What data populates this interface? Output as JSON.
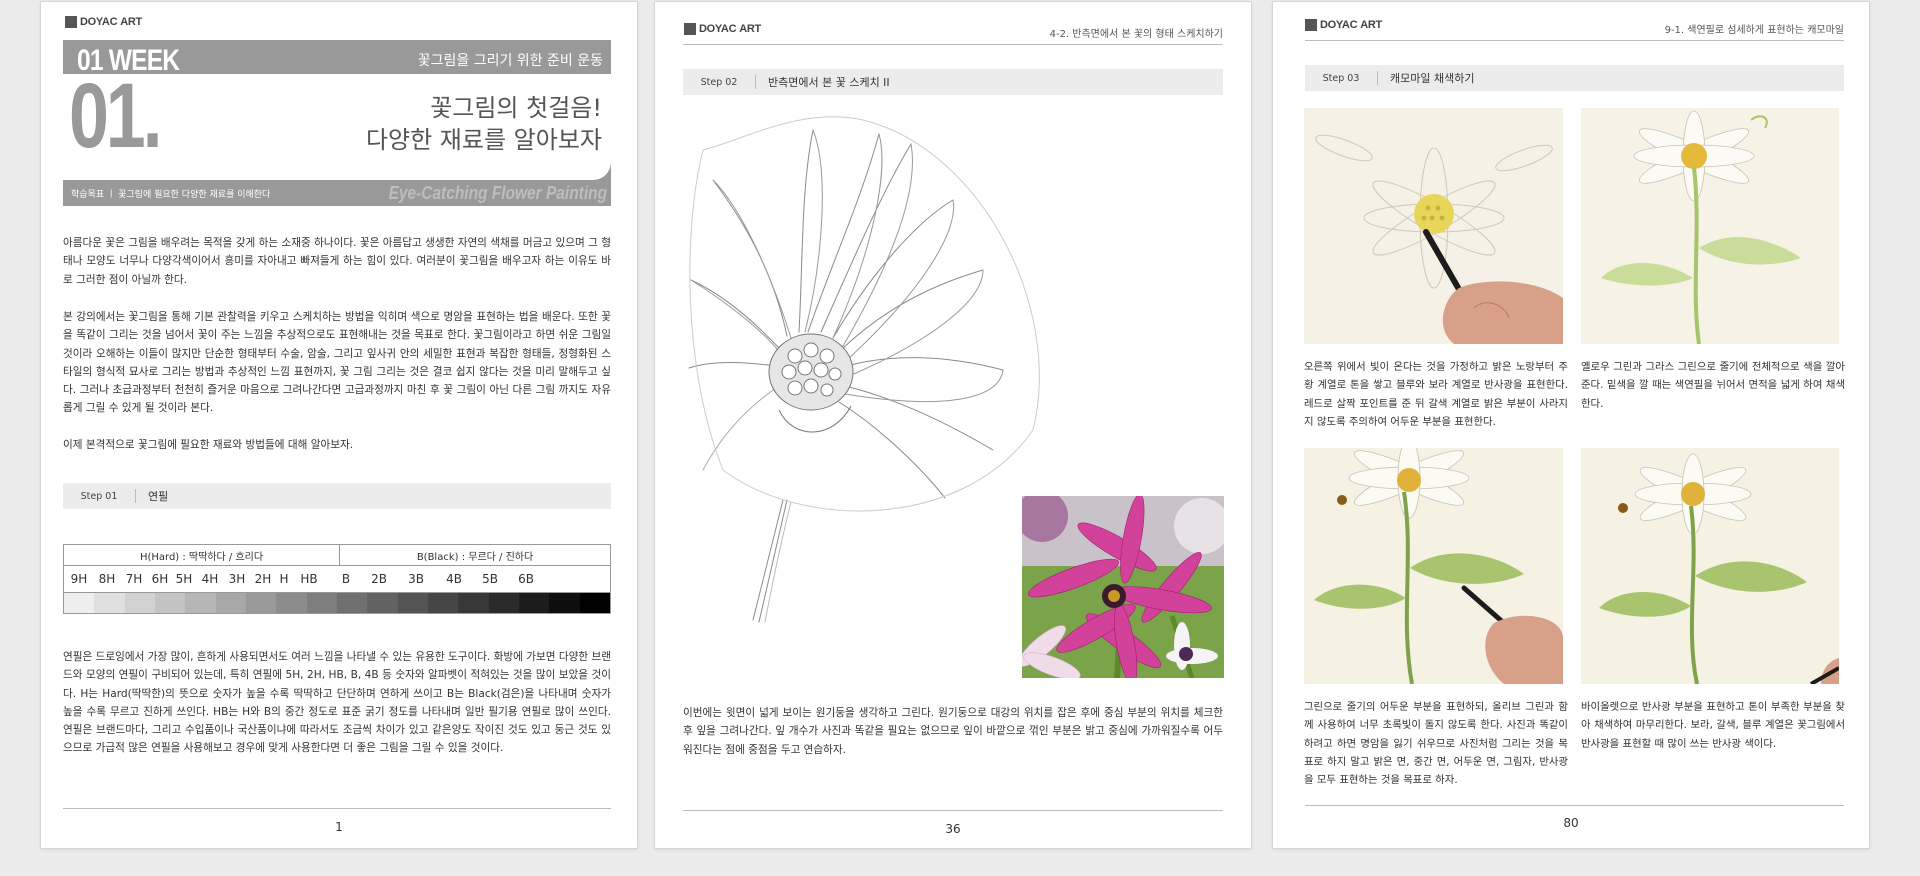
{
  "brand": {
    "logo_text_bold": "DOYAC",
    "logo_text_light": "ART"
  },
  "page1": {
    "week": "01 WEEK",
    "prep": "꽃그림을 그리기 위한 준비 운동",
    "number": "01.",
    "title_line1": "꽃그림의 첫걸음!",
    "title_line2": "다양한 재료를 알아보자",
    "objective": "학습목표 ㅣ 꽃그림에 필요한 다양한 재료를 이해한다",
    "eye_catching": "Eye-Catching Flower Painting",
    "paragraph1": "아름다운 꽃은 그림을 배우려는 목적을 갖게 하는 소재중 하나이다. 꽃은 아름답고 생생한 자연의 색채를 머금고 있으며 그 형태나 모양도 너무나 다양각색이어서 흥미를 자아내고 빠져들게 하는 힘이 있다. 여러분이 꽃그림을 배우고자 하는 이유도 바로 그러한 점이 아닐까 한다.",
    "paragraph2": "본 강의에서는 꽃그림을 통해 기본 관찰력을 키우고 스케치하는 방법을 익히며 색으로 명암을 표현하는 법을 배운다. 또한 꽃을 똑같이 그리는 것을 넘어서 꽃이 주는 느낌을 추상적으로도 표현해내는 것을 목표로 한다. 꽃그림이라고 하면 쉬운 그림일 것이라 오해하는 이들이 많지만 단순한 형태부터 수술, 암술, 그리고 잎사귀 안의 세밀한 표현과 복잡한 형태들, 정형화된 스타일의 형식적 묘사로 그리는 방법과 추상적인 느낌 표현까지, 꽃 그림 그리는 것은 결코 쉽지 않다는 것을 미리 말해두고 싶다. 그러나 초급과정부터 천천히 즐거운 마음으로 그려나간다면 고급과정까지 마친 후 꽃 그림이 아닌 다른 그림 까지도 자유롭게 그릴 수 있게 될 것이라 본다.",
    "paragraph3": "이제 본격적으로 꽃그림에 필요한 재료와 방법들에 대해 알아보자.",
    "step_label": "Step 01",
    "step_title": "연필",
    "scale_hard": "H(Hard) : 딱딱하다 / 흐리다",
    "scale_black": "B(Black) : 무르다 / 진하다",
    "grades": [
      "9H",
      "8H",
      "7H",
      "6H",
      "5H",
      "4H",
      "3H",
      "2H",
      "H",
      "HB",
      "B",
      "2B",
      "3B",
      "4B",
      "5B",
      "6B"
    ],
    "paragraph4": "연필은 드로잉에서 가장 많이, 흔하게 사용되면서도 여러 느낌을 나타낼 수 있는 유용한 도구이다. 화방에 가보면 다양한 브랜드와 모양의 연필이 구비되어 있는데, 특히 연필에 5H, 2H, HB, B, 4B 등 숫자와 알파벳이 적혀있는 것을 많이 보았을 것이다. H는 Hard(딱딱한)의 뜻으로 숫자가 높을 수록 딱딱하고 단단하며 연하게 쓰이고 B는 Black(검은)을 나타내며 숫자가 높을 수록 무르고 진하게 쓰인다. HB는 H와 B의 중간 정도로 표준 굵기 정도를 나타내며 일반 필기용 연필로 많이 쓰인다. 연필은 브랜드마다, 그리고 수입품이나 국산품이냐에 따라서도 조금씩 차이가 있고 같은양도 작이진 것도 있고 둥근 것도 있으므로 가급적 많은 연필을 사용해보고 경우에 맞게 사용한다면 더 좋은 그림을 그릴 수 있을 것이다.",
    "page_number": "1"
  },
  "page2": {
    "running_head": "4-2. 반측면에서 본 꽃의 형태 스케치하기",
    "step_label": "Step 02",
    "step_title": "반측면에서 본 꽃 스케치 II",
    "paragraph": "이번에는 윗면이 넓게 보이는 원기둥을 생각하고 그린다. 원기둥으로 대강의 위치를 잡은 후에 중심 부분의 위치를 체크한 후 잎을 그려나간다. 잎 개수가 사진과 똑같을 필요는 없으므로 잎이 바깥으로 꺾인 부분은 밝고 중심에 가까워질수록 어두워진다는 점에 중점을 두고 연습하자.",
    "page_number": "36"
  },
  "page3": {
    "running_head": "9-1. 색연필로 섬세하게 표현하는 캐모마일",
    "step_label": "Step 03",
    "step_title": "캐모마일 채색하기",
    "caption1": "오른쪽 위에서 빛이 온다는 것을 가정하고 밝은 노랑부터 주황 계열로 톤을 쌓고 블루와 보라 계열로 반사광을 표현한다. 레드로 살짝 포인트를 준 뒤 갈색 계열로 밝은 부분이 사라지지 않도록 주의하여 어두운 부분을 표현한다.",
    "caption2": "옐로우 그린과 그라스 그린으로 줄기에 전체적으로 색을 깔아준다. 밑색을 깔 때는 색연필을 뉘어서 면적을 넓게 하여 채색한다.",
    "caption3": "그린으로 줄기의 어두운 부분을 표현하되, 올리브 그린과 함께 사용하여 너무 초록빛이 돌지 않도록 한다. 사진과 똑같이 하려고 하면 명암을 잃기 쉬우므로 사진처럼 그리는 것을 목표로 하지 말고 밝은 면, 중간 면, 어두운 면, 그림자, 반사광을 모두 표현하는 것을 목표로 하자.",
    "caption4": "바이올렛으로 반사광 부분을 표현하고 톤이 부족한 부분을 찾아 채색하여 마무리한다. 보라, 갈색, 블루 계열은 꽃그림에서 반사광을 표현할 때 많이 쓰는 반사광 색이다.",
    "page_number": "80"
  },
  "colors": {
    "hero_gray": "#999999",
    "step_bg": "#ececec",
    "flower_pink": "#d2419a"
  }
}
